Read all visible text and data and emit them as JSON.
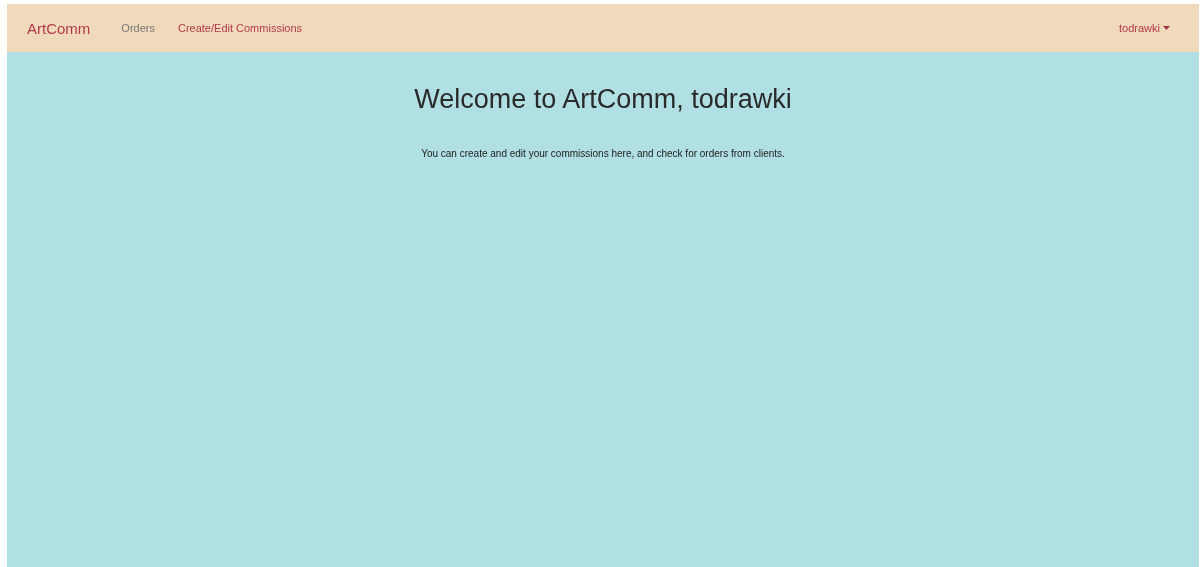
{
  "navbar": {
    "brand": "ArtComm",
    "items": [
      {
        "label": "Orders",
        "selected": false
      },
      {
        "label": "Create/Edit Commissions",
        "selected": true
      }
    ],
    "user_menu": {
      "label": "todrawki"
    }
  },
  "main": {
    "heading": "Welcome to ArtComm, todrawki",
    "text": "You can create and edit your commissions here, and check for orders from clients."
  }
}
